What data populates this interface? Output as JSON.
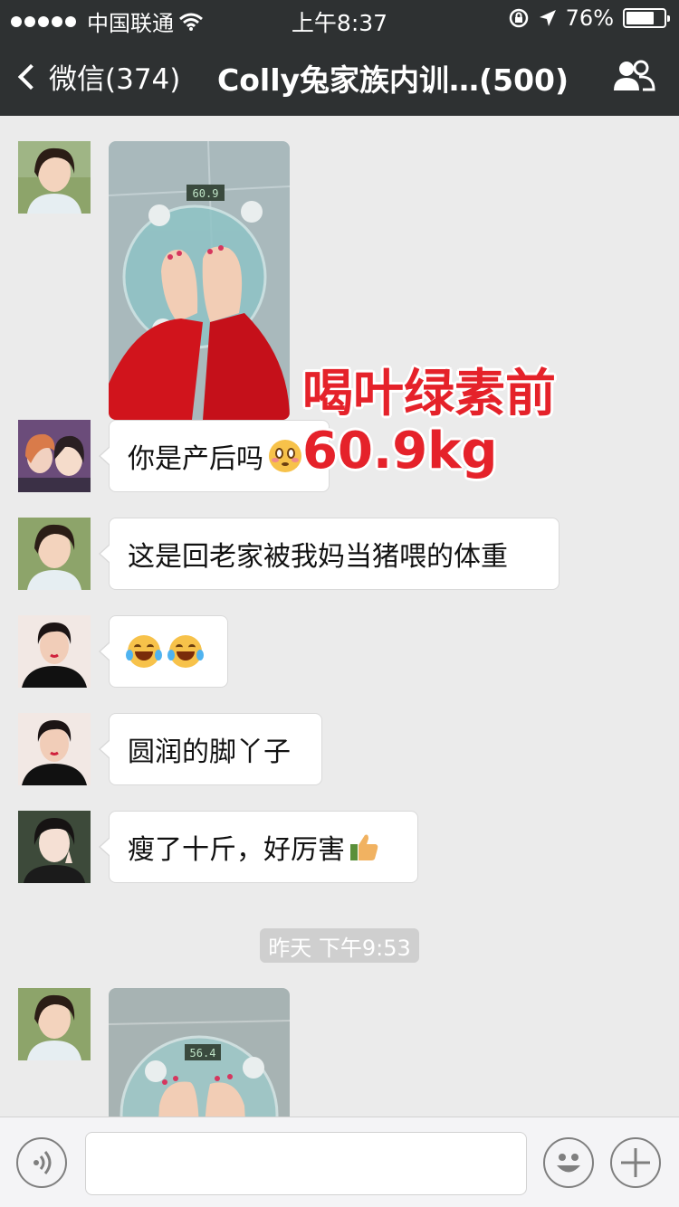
{
  "status_bar": {
    "carrier": "中国联通",
    "time": "上午8:37",
    "battery_percent": "76%",
    "battery_level": 0.76
  },
  "nav": {
    "back_label": "微信(374)",
    "title": "Colly兔家族内训…(500)"
  },
  "messages": [
    {
      "type": "image",
      "content": "scale-photo-before"
    },
    {
      "type": "text",
      "text": "你是产后吗",
      "emoji": "flushed-face-icon"
    },
    {
      "type": "text",
      "text": "这是回老家被我妈当猪喂的体重"
    },
    {
      "type": "emoji",
      "emoji": [
        "laughing-tears-icon",
        "laughing-tears-icon"
      ]
    },
    {
      "type": "text",
      "text": "圆润的脚丫子"
    },
    {
      "type": "text",
      "text": "瘦了十斤，好厉害",
      "emoji": "thumbs-up-icon"
    },
    {
      "type": "image",
      "content": "scale-photo-after"
    }
  ],
  "overlay": {
    "line1": "喝叶绿素前",
    "line2": "60.9kg"
  },
  "photo_scale_readings": {
    "before": "60.9",
    "after": "56.4"
  },
  "timestamp": "昨天 下午9:53",
  "colors": {
    "nav_bg": "#2e3132",
    "chat_bg": "#ebebeb",
    "overlay_red": "#e5222a"
  }
}
